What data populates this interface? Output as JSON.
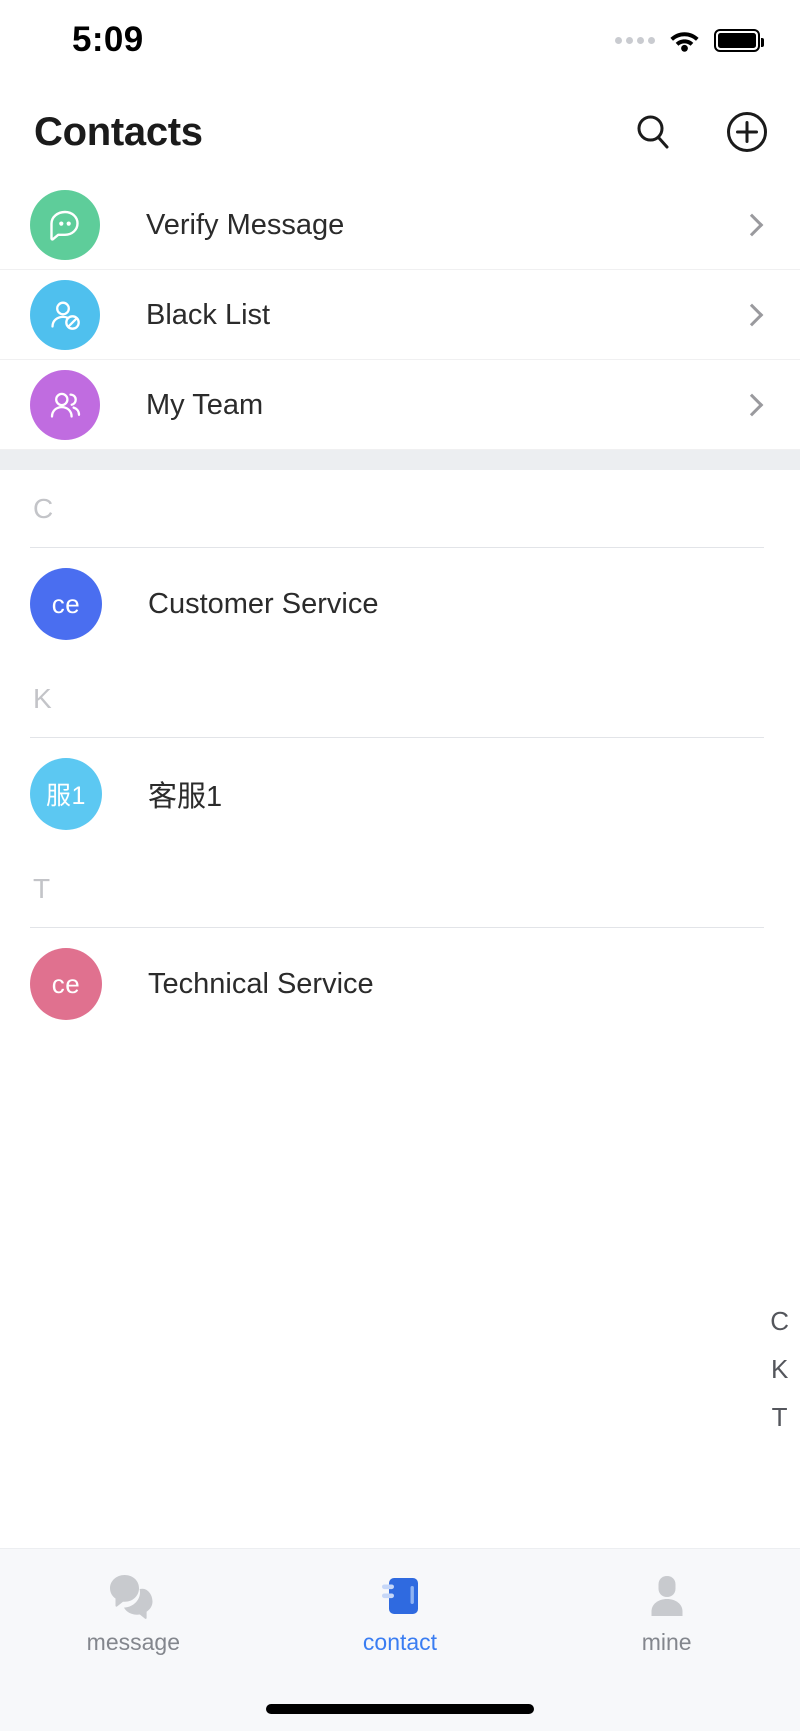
{
  "status_bar": {
    "time": "5:09",
    "signal_icon": "signal-dots-icon",
    "wifi_icon": "wifi-icon",
    "battery_icon": "battery-full-icon"
  },
  "header": {
    "title": "Contacts",
    "search_icon": "search-icon",
    "add_icon": "add-circle-icon"
  },
  "entries": [
    {
      "label": "Verify Message",
      "icon": "verify-message-icon",
      "color": "#5ecd9a",
      "chevron": "chevron-right-icon"
    },
    {
      "label": "Black List",
      "icon": "black-list-icon",
      "color": "#4fc0ee",
      "chevron": "chevron-right-icon"
    },
    {
      "label": "My Team",
      "icon": "my-team-icon",
      "color": "#c06ce0",
      "chevron": "chevron-right-icon"
    }
  ],
  "sections": [
    {
      "letter": "C",
      "contacts": [
        {
          "name": "Customer Service",
          "initials": "ce",
          "color": "#4a6ef0"
        }
      ]
    },
    {
      "letter": "K",
      "contacts": [
        {
          "name": "客服1",
          "initials": "服1",
          "color": "#5cc8f2"
        }
      ]
    },
    {
      "letter": "T",
      "contacts": [
        {
          "name": "Technical Service",
          "initials": "ce",
          "color": "#e0718f"
        }
      ]
    }
  ],
  "index_bar": {
    "letters": [
      "C",
      "K",
      "T"
    ]
  },
  "tabbar": {
    "items": [
      {
        "label": "message",
        "icon": "message-bubbles-icon",
        "active": false
      },
      {
        "label": "contact",
        "icon": "contact-book-icon",
        "active": true
      },
      {
        "label": "mine",
        "icon": "person-icon",
        "active": false
      }
    ],
    "active_color": "#3a7df2",
    "inactive_color": "#c8cace"
  },
  "home_indicator": "home-indicator-bar"
}
